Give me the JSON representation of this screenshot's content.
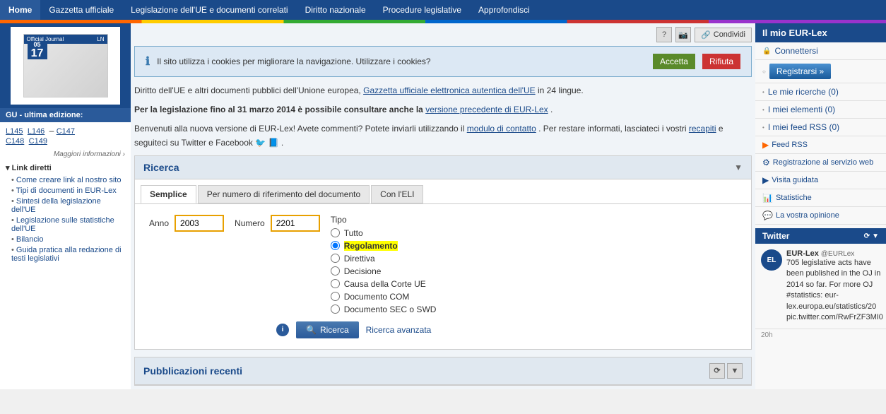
{
  "nav": {
    "home": "Home",
    "items": [
      {
        "label": "Gazzetta ufficiale"
      },
      {
        "label": "Legislazione dell'UE e documenti correlati"
      },
      {
        "label": "Diritto nazionale"
      },
      {
        "label": "Procedure legislative"
      },
      {
        "label": "Approfondisci"
      }
    ]
  },
  "share_btn": "Condividi",
  "cookie": {
    "text": "Il sito utilizza i cookies per migliorare la navigazione. Utilizzare i cookies?",
    "accept": "Accetta",
    "reject": "Rifiuta"
  },
  "main_text1": "Diritto dell'UE e altri documenti pubblici dell'Unione europea,",
  "main_link1": "Gazzetta ufficiale elettronica autentica dell'UE",
  "main_text1b": "in 24 lingue.",
  "main_bold1": "Per la legislazione fino al 31 marzo 2014 è possibile consultare anche la",
  "main_link2": "versione precedente di EUR-Lex",
  "main_text2b": ".",
  "main_text3": "Benvenuti alla nuova versione di EUR-Lex! Avete commenti? Potete inviarli utilizzando il",
  "main_link3": "modulo di contatto",
  "main_text3b": ". Per restare informati, lasciateci i vostri",
  "main_link4": "recapiti",
  "main_text3c": "e seguiteci su Twitter e Facebook",
  "search": {
    "title": "Ricerca",
    "tab_simple": "Semplice",
    "tab_reference": "Per numero di riferimento del documento",
    "tab_eli": "Con l'ELI",
    "anno_label": "Anno",
    "anno_value": "2003",
    "numero_label": "Numero",
    "numero_value": "2201",
    "tipo_label": "Tipo",
    "options": [
      {
        "label": "Tutto",
        "selected": false
      },
      {
        "label": "Regolamento",
        "selected": true
      },
      {
        "label": "Direttiva",
        "selected": false
      },
      {
        "label": "Decisione",
        "selected": false
      },
      {
        "label": "Causa della Corte UE",
        "selected": false
      },
      {
        "label": "Documento COM",
        "selected": false
      },
      {
        "label": "Documento SEC o SWD",
        "selected": false
      }
    ],
    "search_btn": "Ricerca",
    "advanced_btn": "Ricerca avanzata"
  },
  "publications": {
    "title": "Pubblicazioni recenti"
  },
  "sidebar": {
    "gu_label": "GU - ultima edizione:",
    "links": [
      "L145",
      "L146",
      "–",
      "C147",
      "C148",
      "C149"
    ],
    "more_info": "Maggiori informazioni ›",
    "direct_links_title": "▾ Link diretti",
    "direct_links": [
      "Come creare link al nostro sito",
      "Tipi di documenti in EUR-Lex",
      "Sintesi della legislazione dell'UE",
      "Legislazione sulle statistiche dell'UE",
      "Bilancio",
      "Guida pratica alla redazione di testi legislativi"
    ]
  },
  "right_sidebar": {
    "title": "Il mio EUR-Lex",
    "connect": "Connettersi",
    "register": "Registrarsi »",
    "links": [
      {
        "label": "Le mie ricerche (0)"
      },
      {
        "label": "I miei elementi (0)"
      },
      {
        "label": "I miei feed RSS (0)"
      }
    ],
    "extra_links": [
      {
        "icon": "rss",
        "label": "Feed RSS"
      },
      {
        "icon": "gear",
        "label": "Registrazione al servizio web"
      },
      {
        "icon": "play",
        "label": "Visita guidata"
      },
      {
        "icon": "chart",
        "label": "Statistiche"
      },
      {
        "icon": "chart2",
        "label": "La vostra opinione"
      }
    ],
    "twitter": {
      "title": "Twitter",
      "user": "EUR-Lex",
      "handle": "@EURLex",
      "avatar_text": "EL",
      "text": "705 legislative acts have been published in the OJ in 2014 so far. For more OJ #statistics: eur-lex.europa.eu/statistics/20 pic.twitter.com/RwFrZF3MI0",
      "time": "20h"
    }
  }
}
